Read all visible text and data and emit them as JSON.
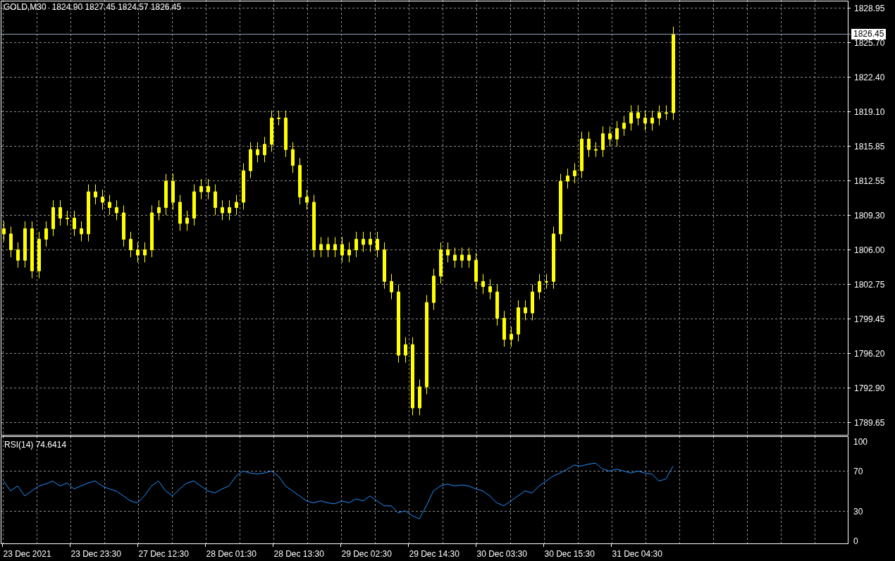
{
  "price_chart": {
    "symbol": "GOLD,M30",
    "ohlc": [
      "1824.90",
      "1827.45",
      "1824.57",
      "1826.45"
    ],
    "current_price": "1826.45",
    "price_axis_labels": [
      "1828.95",
      "1825.70",
      "1822.40",
      "1819.10",
      "1815.85",
      "1812.55",
      "1809.30",
      "1806.00",
      "1802.75",
      "1799.45",
      "1796.20",
      "1792.90",
      "1789.65"
    ]
  },
  "rsi_chart": {
    "value": "74.6414",
    "time_axis_labels": [
      "23 Dec 2021",
      "23 Dec 23:30",
      "27 Dec 12:30",
      "28 Dec 01:30",
      "28 Dec 13:30",
      "29 Dec 02:30",
      "29 Dec 14:30",
      "30 Dec 03:30",
      "30 Dec 15:30",
      "31 Dec 04:30"
    ],
    "chart_data": {
      "type": "line",
      "ylim": [
        -2.8,
        104.3
      ],
      "yticks": [
        100,
        70,
        30,
        0
      ],
      "grid": true,
      "series": [
        {
          "name": "RSI(14)",
          "color": "#1e90ff",
          "values": [
            60,
            50,
            55,
            45,
            50,
            55,
            57,
            60,
            55,
            58,
            52,
            55,
            58,
            60,
            55,
            52,
            50,
            45,
            40,
            38,
            45,
            55,
            60,
            50,
            45,
            52,
            58,
            60,
            55,
            50,
            48,
            52,
            55,
            65,
            70,
            68,
            67,
            68,
            70,
            65,
            55,
            50,
            45,
            40,
            38,
            40,
            38,
            37,
            40,
            38,
            42,
            40,
            45,
            40,
            35,
            35,
            28,
            30,
            25,
            22,
            35,
            50,
            55,
            57,
            55,
            56,
            55,
            52,
            50,
            45,
            38,
            35,
            40,
            45,
            50,
            48,
            55,
            60,
            65,
            68,
            72,
            76,
            75,
            77,
            78,
            72,
            70,
            72,
            70,
            68,
            70,
            68,
            67,
            60,
            62,
            75
          ]
        }
      ]
    }
  }
}
